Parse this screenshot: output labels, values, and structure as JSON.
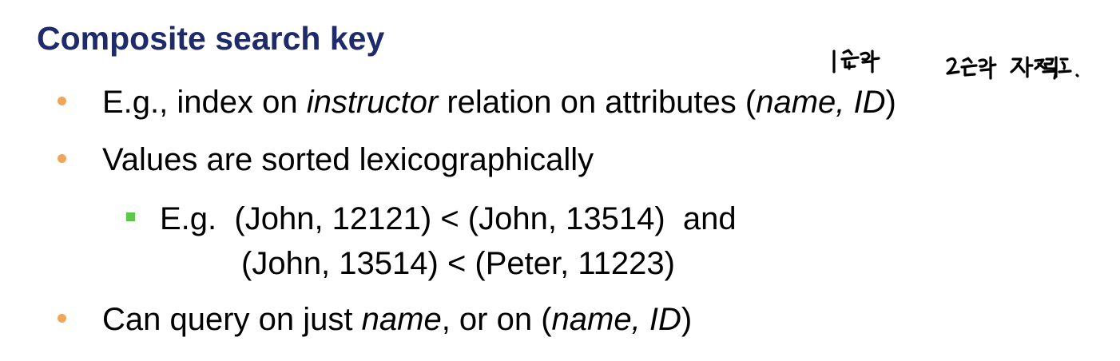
{
  "title": "Composite search key",
  "colors": {
    "title": "#1f2a6b",
    "bullet_level1": "#f2a45a",
    "bullet_level2": "#5cc84a",
    "text": "#000000"
  },
  "bullets": [
    {
      "icon": "orange-dot-bullet",
      "parts": [
        "E.g., index on ",
        "instructor",
        " relation on attributes (",
        "name, ID",
        ")"
      ]
    },
    {
      "icon": "orange-dot-bullet",
      "parts": [
        "Values are sorted lexicographically"
      ]
    },
    {
      "icon": "orange-dot-bullet",
      "parts": [
        "Can query on just ",
        "name",
        ", or on (",
        "name, ID",
        ")"
      ]
    }
  ],
  "sub_bullet": {
    "icon": "green-square-bullet",
    "line1": "E.g.  (John, 12121) < (John, 13514)  and",
    "line2": "(John, 13514) < (Peter, 11223)"
  },
  "annotations": {
    "note1": "1순위",
    "note2": "2순위 정렬."
  }
}
